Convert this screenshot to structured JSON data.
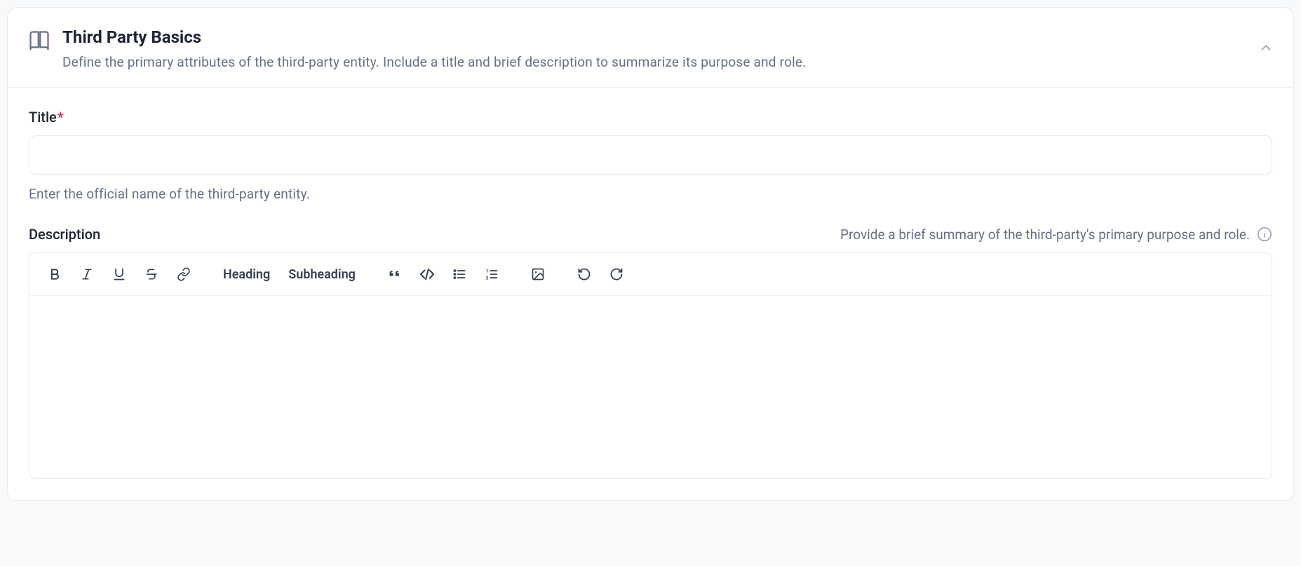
{
  "panel": {
    "title": "Third Party Basics",
    "subtitle": "Define the primary attributes of the third-party entity. Include a title and brief description to summarize its purpose and role."
  },
  "fields": {
    "title": {
      "label": "Title",
      "required_mark": "*",
      "value": "",
      "helper": "Enter the official name of the third-party entity."
    },
    "description": {
      "label": "Description",
      "hint": "Provide a brief summary of the third-party's primary purpose and role.",
      "value": ""
    }
  },
  "toolbar": {
    "heading": "Heading",
    "subheading": "Subheading"
  }
}
